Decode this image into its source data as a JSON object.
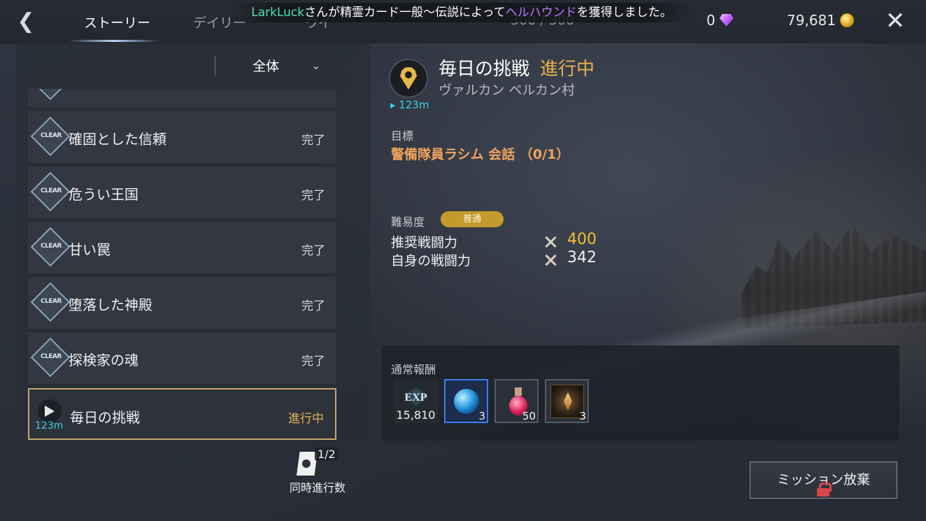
{
  "header": {
    "tabs": [
      "ストーリー",
      "デイリー",
      "ウイ"
    ],
    "stamina": "300 / 300",
    "ticker": {
      "name": "LarkLuck",
      "middle": "さんが精霊カード一般～伝説によって",
      "item": "ヘルハウンド",
      "end": "を獲得しました。"
    },
    "gems": "0",
    "gold": "79,681"
  },
  "filter": {
    "label": "全体"
  },
  "quests": [
    {
      "title": "確固とした信頼",
      "status": "完了",
      "badge": "CLEAR"
    },
    {
      "title": "危うい王国",
      "status": "完了",
      "badge": "CLEAR"
    },
    {
      "title": "甘い罠",
      "status": "完了",
      "badge": "CLEAR"
    },
    {
      "title": "堕落した神殿",
      "status": "完了",
      "badge": "CLEAR"
    },
    {
      "title": "探検家の魂",
      "status": "完了",
      "badge": "CLEAR"
    }
  ],
  "active_quest": {
    "title": "毎日の挑戦",
    "status": "進行中",
    "distance": "123m"
  },
  "parallel": {
    "count": "1/2",
    "label": "同時進行数"
  },
  "detail": {
    "title": "毎日の挑戦",
    "state": "進行中",
    "location": "ヴァルカン ベルカン村",
    "distance": "123m",
    "objective_label": "目標",
    "objective": "警備隊員ラシム 会話 （0/1）",
    "difficulty_label": "難易度",
    "difficulty": "普通",
    "recommended_label": "推奨戦闘力",
    "recommended_value": "400",
    "own_label": "自身の戦闘力",
    "own_value": "342",
    "reward_label": "通常報酬",
    "exp_label": "EXP",
    "exp_value": "15,810",
    "rewards": [
      {
        "icon": "blue-orb-icon",
        "qty": "3"
      },
      {
        "icon": "red-potion-icon",
        "qty": "50"
      },
      {
        "icon": "scroll-item-icon",
        "qty": "3"
      }
    ]
  },
  "abandon_button": "ミッション放棄",
  "colors": {
    "accent_gold": "#e7b24f",
    "objective_orange": "#f0a35c",
    "distance_cyan": "#39d3e0",
    "recommended_yellow": "#f0c030"
  }
}
